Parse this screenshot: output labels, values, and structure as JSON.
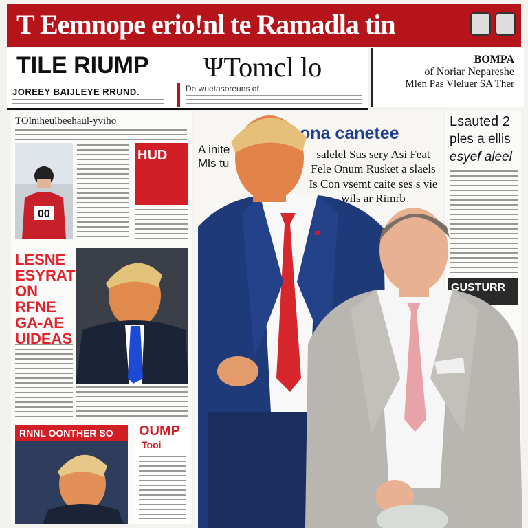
{
  "banner": {
    "title": "T Eemnope erio!nl te Ramadla tin"
  },
  "masthead": {
    "left": "TILE RIUMP",
    "right": "ΨTomcl lo"
  },
  "side_header": {
    "line1": "BOMPA",
    "line2": "of Noriar Nepareshe",
    "line3": "Mlen Pas Vleluer SA Ther"
  },
  "subrow": {
    "left": "JOREEY BAIJLEYE RRUND.",
    "right": "De wuetasoreuns of"
  },
  "left_col": {
    "top_caption": "TOlniheulbeehaul-yviho",
    "headline_red": "LESNE ESYRATS ON RFNE GA-AE UIDEAS",
    "badge_hud": "HUD"
  },
  "center": {
    "headline": "ona canetee",
    "small_left": "A inite Mls tu",
    "block": "salelel Sus sery Asi Feat Fele Onum Rusket a slaels Is Con vsemt caite ses s vie wils ar Rimrb"
  },
  "right_col": {
    "head1": "Lsauted 2",
    "head2": "ples a ellis",
    "head3": "esyef aleel",
    "box": "GUSTURR"
  },
  "bottom": {
    "red_headline": "RNNL OONTHER SO",
    "oump": "OUMP",
    "tooi": "Tooi"
  },
  "colors": {
    "banner": "#b5141b",
    "accent_red": "#d21f26",
    "suit_navy": "#1f3a78",
    "tie_red": "#d7262c",
    "suit_grey": "#b9b6b1"
  }
}
